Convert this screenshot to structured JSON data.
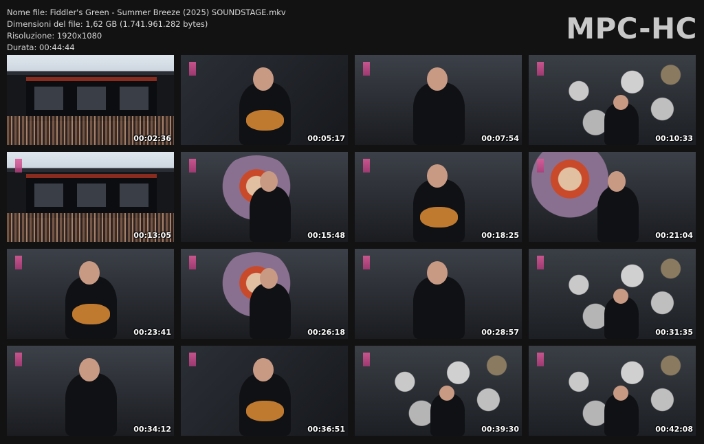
{
  "info": {
    "file_name": "Nome file: Fiddler's Green - Summer Breeze (2025) SOUNDSTAGE.mkv",
    "file_size": "Dimensioni del file: 1,62 GB (1.741.961.282 bytes)",
    "resolution": "Risoluzione: 1920x1080",
    "duration": "Durata: 00:44:44"
  },
  "logo": "MPC-HC",
  "thumbnails": [
    {
      "time": "00:02:36",
      "scene": "crowd-stage"
    },
    {
      "time": "00:05:17",
      "scene": "bass-guitar"
    },
    {
      "time": "00:07:54",
      "scene": "singer-pointing"
    },
    {
      "time": "00:10:33",
      "scene": "drum-kit"
    },
    {
      "time": "00:13:05",
      "scene": "crowd-stage"
    },
    {
      "time": "00:15:48",
      "scene": "band-banner"
    },
    {
      "time": "00:18:25",
      "scene": "singer-guitar"
    },
    {
      "time": "00:21:04",
      "scene": "fiddler-banner"
    },
    {
      "time": "00:23:41",
      "scene": "guitar-accordion"
    },
    {
      "time": "00:26:18",
      "scene": "singer-banner"
    },
    {
      "time": "00:28:57",
      "scene": "singer-mic"
    },
    {
      "time": "00:31:35",
      "scene": "drum-kit"
    },
    {
      "time": "00:34:12",
      "scene": "singer-closeup"
    },
    {
      "time": "00:36:51",
      "scene": "fiddler-closeup"
    },
    {
      "time": "00:39:30",
      "scene": "drum-kit"
    },
    {
      "time": "00:42:08",
      "scene": "drum-kit"
    }
  ]
}
